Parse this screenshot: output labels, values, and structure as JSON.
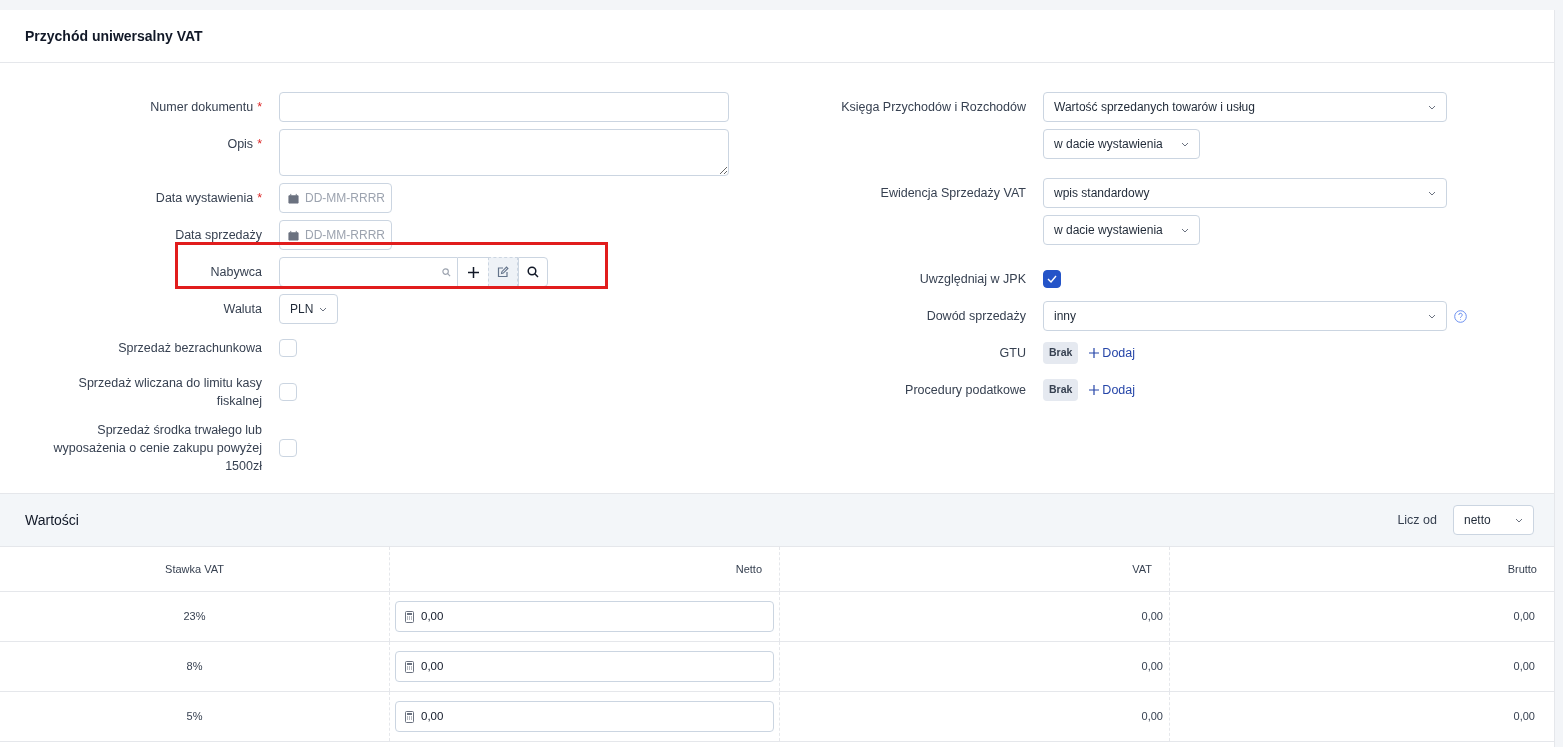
{
  "title": "Przychód uniwersalny VAT",
  "required_mark": "*",
  "left_fields": [
    {
      "kind": "text",
      "label": "Numer dokumentu",
      "required": true
    },
    {
      "kind": "textarea",
      "label": "Opis",
      "required": true
    },
    {
      "kind": "date",
      "label": "Data wystawienia",
      "required": true,
      "placeholder": "DD-MM-RRRR"
    },
    {
      "kind": "date",
      "label": "Data sprzedaży",
      "required": false,
      "placeholder": "DD-MM-RRRR"
    },
    {
      "kind": "buyer",
      "label": "Nabywca",
      "required": false
    },
    {
      "kind": "select",
      "label": "Waluta",
      "required": false,
      "value": "PLN"
    },
    {
      "kind": "checkbox",
      "label": "Sprzedaż bezrachunkowa",
      "checked": false
    },
    {
      "kind": "checkbox",
      "label": "Sprzedaż wliczana do limitu kasy fiskalnej",
      "checked": false
    },
    {
      "kind": "checkbox",
      "label": "Sprzedaż środka trwałego lub wyposażenia o cenie zakupu powyżej 1500zł",
      "checked": false
    }
  ],
  "right_fields": [
    {
      "kind": "selects",
      "label": "Księga Przychodów i Rozchodów",
      "values": [
        "Wartość sprzedanych towarów i usług",
        "w dacie wystawienia"
      ]
    },
    {
      "kind": "selects",
      "label": "Ewidencja Sprzedaży VAT",
      "values": [
        "wpis standardowy",
        "w dacie wystawienia"
      ]
    },
    {
      "kind": "checkbox",
      "label": "Uwzględniaj w JPK",
      "checked": true
    },
    {
      "kind": "select_help",
      "label": "Dowód sprzedaży",
      "value": "inny"
    },
    {
      "kind": "tags",
      "label": "GTU",
      "tag": "Brak",
      "link": "Dodaj"
    },
    {
      "kind": "tags",
      "label": "Procedury podatkowe",
      "tag": "Brak",
      "link": "Dodaj"
    }
  ],
  "values": {
    "title": "Wartości",
    "calc_label": "Licz od",
    "calc_value": "netto",
    "columns": [
      "Stawka VAT",
      "Netto",
      "VAT",
      "Brutto"
    ],
    "rows": [
      {
        "rate": "23%",
        "netto": "0,00",
        "vat": "0,00",
        "brutto": "0,00"
      },
      {
        "rate": "8%",
        "netto": "0,00",
        "vat": "0,00",
        "brutto": "0,00"
      },
      {
        "rate": "5%",
        "netto": "0,00",
        "vat": "0,00",
        "brutto": "0,00"
      }
    ]
  }
}
